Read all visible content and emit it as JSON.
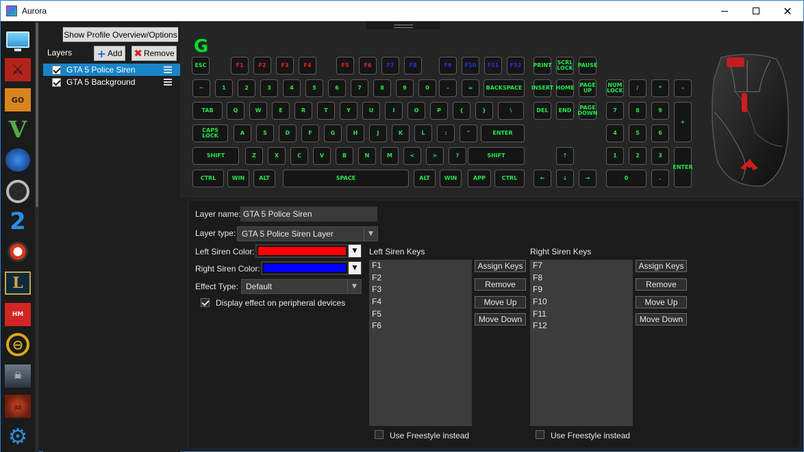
{
  "window": {
    "title": "Aurora",
    "minimize_icon": "minimize-icon",
    "maximize_icon": "maximize-icon",
    "close_icon": "close-icon"
  },
  "profiles": [
    {
      "name": "desktop",
      "icon": "monitor-icon",
      "glyph": ""
    },
    {
      "name": "dota-2",
      "icon": "dota-icon",
      "glyph": "⚔"
    },
    {
      "name": "csgo",
      "icon": "csgo-icon",
      "glyph": "GO"
    },
    {
      "name": "gta-5",
      "icon": "gta-icon",
      "glyph": "V"
    },
    {
      "name": "rocket-league",
      "icon": "rocket-league-icon",
      "glyph": ""
    },
    {
      "name": "overwatch",
      "icon": "overwatch-icon",
      "glyph": ""
    },
    {
      "name": "payday-2",
      "icon": "payday-icon",
      "glyph": "2"
    },
    {
      "name": "the-division",
      "icon": "division-icon",
      "glyph": ""
    },
    {
      "name": "league-of-legends",
      "icon": "lol-icon",
      "glyph": "L"
    },
    {
      "name": "hotline-miami",
      "icon": "hotline-icon",
      "glyph": "HM"
    },
    {
      "name": "dishonored",
      "icon": "dishonored-icon",
      "glyph": "⊖"
    },
    {
      "name": "payday-2-heist",
      "icon": "heister-icon",
      "glyph": "☠"
    },
    {
      "name": "doom",
      "icon": "doom-icon",
      "glyph": "☠"
    },
    {
      "name": "settings",
      "icon": "gear-icon",
      "glyph": "⚙"
    }
  ],
  "layers_panel": {
    "overview_button": "Show Profile Overview/Options",
    "layers_label": "Layers",
    "add_button": "Add",
    "remove_button": "Remove",
    "layers": [
      {
        "name": "GTA 5 Police Siren",
        "checked": true,
        "selected": true
      },
      {
        "name": "GTA 5 Background",
        "checked": true,
        "selected": false
      }
    ]
  },
  "keyboard": {
    "logo": "G",
    "keys": [
      {
        "label": "ESC",
        "c": "g"
      },
      {
        "label": "F1",
        "c": "r"
      },
      {
        "label": "F2",
        "c": "r"
      },
      {
        "label": "F3",
        "c": "r"
      },
      {
        "label": "F4",
        "c": "r"
      },
      {
        "label": "F5",
        "c": "r"
      },
      {
        "label": "F6",
        "c": "r"
      },
      {
        "label": "F7",
        "c": "b"
      },
      {
        "label": "F8",
        "c": "b"
      },
      {
        "label": "F9",
        "c": "b"
      },
      {
        "label": "F10",
        "c": "b"
      },
      {
        "label": "F11",
        "c": "b"
      },
      {
        "label": "F12",
        "c": "b"
      },
      {
        "label": "PRINT",
        "c": "g"
      },
      {
        "label": "SCRL LOCK",
        "c": "g"
      },
      {
        "label": "PAUSE",
        "c": "g"
      },
      {
        "label": "~",
        "c": "g"
      },
      {
        "label": "1",
        "c": "g"
      },
      {
        "label": "2",
        "c": "g"
      },
      {
        "label": "3",
        "c": "g"
      },
      {
        "label": "4",
        "c": "g"
      },
      {
        "label": "5",
        "c": "g"
      },
      {
        "label": "6",
        "c": "g"
      },
      {
        "label": "7",
        "c": "g"
      },
      {
        "label": "8",
        "c": "g"
      },
      {
        "label": "9",
        "c": "g"
      },
      {
        "label": "0",
        "c": "g"
      },
      {
        "label": "-",
        "c": "g"
      },
      {
        "label": "=",
        "c": "g"
      },
      {
        "label": "BACKSPACE",
        "c": "g"
      },
      {
        "label": "INSERT",
        "c": "g"
      },
      {
        "label": "HOME",
        "c": "g"
      },
      {
        "label": "PAGE UP",
        "c": "g"
      },
      {
        "label": "NUM LOCK",
        "c": "g"
      },
      {
        "label": "/",
        "c": "g"
      },
      {
        "label": "*",
        "c": "g"
      },
      {
        "label": "-",
        "c": "g"
      },
      {
        "label": "TAB",
        "c": "g"
      },
      {
        "label": "Q",
        "c": "g"
      },
      {
        "label": "W",
        "c": "g"
      },
      {
        "label": "E",
        "c": "g"
      },
      {
        "label": "R",
        "c": "g"
      },
      {
        "label": "T",
        "c": "g"
      },
      {
        "label": "Y",
        "c": "g"
      },
      {
        "label": "U",
        "c": "g"
      },
      {
        "label": "I",
        "c": "g"
      },
      {
        "label": "O",
        "c": "g"
      },
      {
        "label": "P",
        "c": "g"
      },
      {
        "label": "{",
        "c": "g"
      },
      {
        "label": "}",
        "c": "g"
      },
      {
        "label": "\\",
        "c": "g"
      },
      {
        "label": "DEL",
        "c": "g"
      },
      {
        "label": "END",
        "c": "g"
      },
      {
        "label": "PAGE DOWN",
        "c": "g"
      },
      {
        "label": "7",
        "c": "g"
      },
      {
        "label": "8",
        "c": "g"
      },
      {
        "label": "9",
        "c": "g"
      },
      {
        "label": "+",
        "c": "g"
      },
      {
        "label": "CAPS LOCK",
        "c": "g"
      },
      {
        "label": "A",
        "c": "g"
      },
      {
        "label": "S",
        "c": "g"
      },
      {
        "label": "D",
        "c": "g"
      },
      {
        "label": "F",
        "c": "g"
      },
      {
        "label": "G",
        "c": "g"
      },
      {
        "label": "H",
        "c": "g"
      },
      {
        "label": "J",
        "c": "g"
      },
      {
        "label": "K",
        "c": "g"
      },
      {
        "label": "L",
        "c": "g"
      },
      {
        "label": ":",
        "c": "g"
      },
      {
        "label": "\"",
        "c": "g"
      },
      {
        "label": "ENTER",
        "c": "g"
      },
      {
        "label": "4",
        "c": "g"
      },
      {
        "label": "5",
        "c": "g"
      },
      {
        "label": "6",
        "c": "g"
      },
      {
        "label": "SHIFT",
        "c": "g"
      },
      {
        "label": "Z",
        "c": "g"
      },
      {
        "label": "X",
        "c": "g"
      },
      {
        "label": "C",
        "c": "g"
      },
      {
        "label": "V",
        "c": "g"
      },
      {
        "label": "B",
        "c": "g"
      },
      {
        "label": "N",
        "c": "g"
      },
      {
        "label": "M",
        "c": "g"
      },
      {
        "label": "<",
        "c": "g"
      },
      {
        "label": ">",
        "c": "g"
      },
      {
        "label": "?",
        "c": "g"
      },
      {
        "label": "SHIFT",
        "c": "g"
      },
      {
        "label": "↑",
        "c": "g"
      },
      {
        "label": "1",
        "c": "g"
      },
      {
        "label": "2",
        "c": "g"
      },
      {
        "label": "3",
        "c": "g"
      },
      {
        "label": "ENTER",
        "c": "g"
      },
      {
        "label": "CTRL",
        "c": "g"
      },
      {
        "label": "WIN",
        "c": "g"
      },
      {
        "label": "ALT",
        "c": "g"
      },
      {
        "label": "SPACE",
        "c": "g"
      },
      {
        "label": "ALT",
        "c": "g"
      },
      {
        "label": "WIN",
        "c": "g"
      },
      {
        "label": "APP",
        "c": "g"
      },
      {
        "label": "CTRL",
        "c": "g"
      },
      {
        "label": "←",
        "c": "g"
      },
      {
        "label": "↓",
        "c": "g"
      },
      {
        "label": "→",
        "c": "g"
      },
      {
        "label": "0",
        "c": "g"
      },
      {
        "label": ".",
        "c": "g"
      }
    ]
  },
  "colors": {
    "green_key": "#22e84a",
    "red_key": "#e82222",
    "blue_key": "#2233e8",
    "selected_row": "#1a84c8",
    "left_siren": "#ff0000",
    "right_siren": "#0000ff"
  },
  "layer_settings": {
    "layer_name_label": "Layer name:",
    "layer_name_value": "GTA 5 Police Siren",
    "layer_type_label": "Layer type:",
    "layer_type_value": "GTA 5 Police Siren Layer",
    "left_color_label": "Left Siren Color:",
    "right_color_label": "Right Siren Color:",
    "effect_type_label": "Effect Type:",
    "effect_type_value": "Default",
    "peripheral_label": "Display effect on peripheral devices",
    "peripheral_checked": true,
    "left_keys_title": "Left Siren Keys",
    "left_keys": [
      "F1",
      "F2",
      "F3",
      "F4",
      "F5",
      "F6"
    ],
    "right_keys_title": "Right Siren Keys",
    "right_keys": [
      "F7",
      "F8",
      "F9",
      "F10",
      "F11",
      "F12"
    ],
    "assign_keys": "Assign Keys",
    "remove": "Remove",
    "move_up": "Move Up",
    "move_down": "Move Down",
    "use_freestyle": "Use Freestyle instead"
  }
}
